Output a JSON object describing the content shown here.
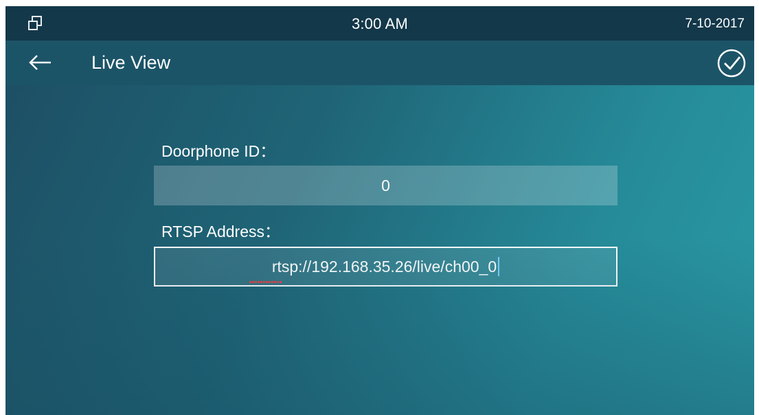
{
  "status_bar": {
    "icon": "windows-icon",
    "time": "3:00 AM",
    "date": "7-10-2017"
  },
  "title_bar": {
    "back_icon": "arrow-left-icon",
    "title": "Live View",
    "confirm_icon": "check-circle-icon"
  },
  "form": {
    "doorphone_id": {
      "label": "Doorphone ID：",
      "value": "0"
    },
    "rtsp_address": {
      "label": "RTSP Address：",
      "value": "rtsp://192.168.35.26/live/ch00_0",
      "focused": true
    }
  },
  "colors": {
    "status_bar": "#13384a",
    "title_bar": "#1c5467",
    "background_left": "#1d4d63",
    "background_right": "#2a9aa5",
    "caret": "#7fd3ff",
    "spellcheck": "#e0454a"
  }
}
